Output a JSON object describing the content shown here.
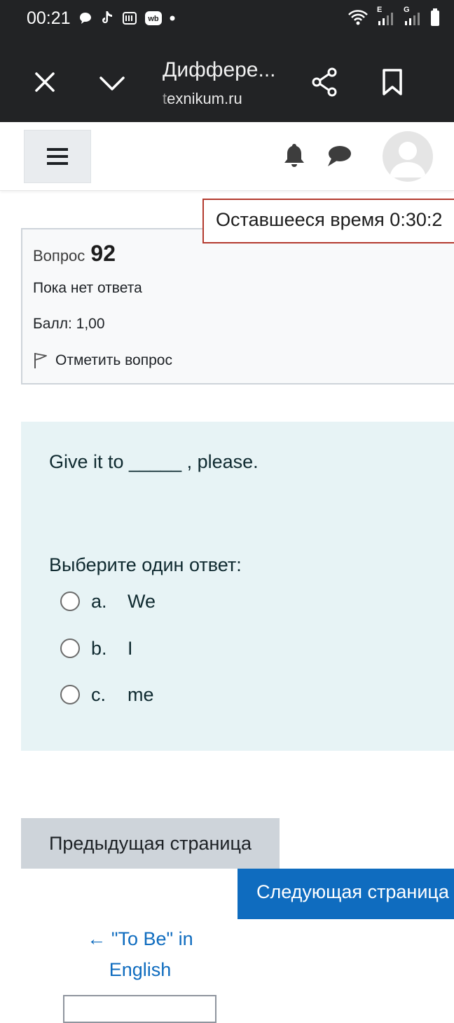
{
  "status_bar": {
    "time": "00:21",
    "network_labels": [
      "E",
      "G"
    ]
  },
  "browser": {
    "page_title": "Диффере...",
    "domain_prefix": "t",
    "domain_rest": "exnikum.ru"
  },
  "timer": {
    "text": "Оставшееся время 0:30:2"
  },
  "question_info": {
    "label": "Вопрос",
    "number": "92",
    "state": "Пока нет ответа",
    "grade": "Балл: 1,00",
    "flag_label": "Отметить вопрос"
  },
  "question": {
    "text": "Give it to _____ , please.",
    "prompt": "Выберите один ответ:",
    "answers": [
      {
        "letter": "a.",
        "text": "We"
      },
      {
        "letter": "b.",
        "text": "I"
      },
      {
        "letter": "c.",
        "text": "me"
      }
    ]
  },
  "navigation": {
    "prev_button": "Предыдущая страница",
    "next_button": "Следующая страница",
    "prev_activity_link": "← \"To Be\" in English"
  },
  "colors": {
    "topbar": "#222325",
    "timer_border": "#b33a2e",
    "question_bg": "#e7f3f5",
    "primary": "#0f6cbf",
    "secondary_btn": "#ced4da"
  }
}
